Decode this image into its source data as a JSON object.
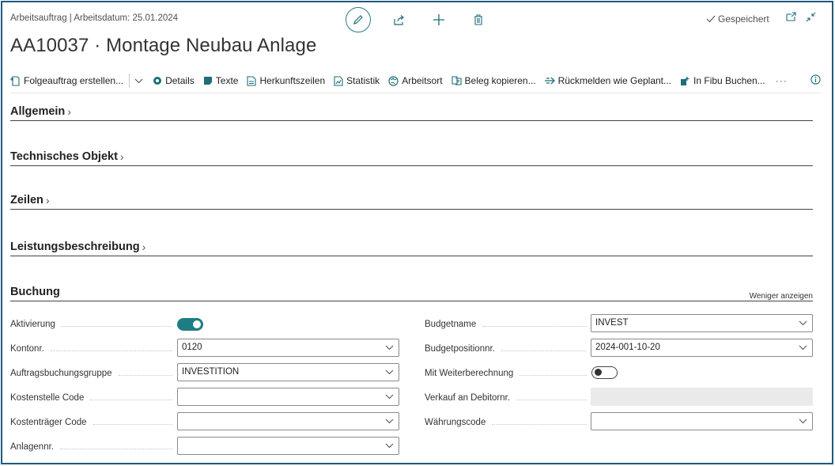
{
  "header": {
    "breadcrumb": "Arbeitsauftrag | Arbeitsdatum: 25.01.2024",
    "title": "AA10037 · Montage Neubau Anlage",
    "saved_label": "Gespeichert"
  },
  "toolbar": {
    "items": [
      {
        "label": "Folgeauftrag erstellen...",
        "icon": "new-document-icon"
      },
      {
        "label": "Details",
        "icon": "details-icon"
      },
      {
        "label": "Texte",
        "icon": "text-icon"
      },
      {
        "label": "Herkunftszeilen",
        "icon": "document-lines-icon"
      },
      {
        "label": "Statistik",
        "icon": "statistics-icon"
      },
      {
        "label": "Arbeitsort",
        "icon": "globe-icon"
      },
      {
        "label": "Beleg kopieren...",
        "icon": "copy-document-icon"
      },
      {
        "label": "Rückmelden wie Geplant...",
        "icon": "report-back-icon"
      },
      {
        "label": "In Fibu Buchen...",
        "icon": "post-icon"
      }
    ],
    "more_label": "···"
  },
  "sections": {
    "allgemein": "Allgemein",
    "technisches_objekt": "Technisches Objekt",
    "zeilen": "Zeilen",
    "leistungsbeschreibung": "Leistungsbeschreibung",
    "buchung": "Buchung",
    "less_label": "Weniger anzeigen"
  },
  "buchung": {
    "aktivierung": {
      "label": "Aktivierung",
      "value": true
    },
    "kontonr": {
      "label": "Kontonr.",
      "value": "0120"
    },
    "auftragsbuchungsgruppe": {
      "label": "Auftragsbuchungsgruppe",
      "value": "INVESTITION"
    },
    "kostenstelle": {
      "label": "Kostenstelle Code",
      "value": ""
    },
    "kostentraeger": {
      "label": "Kostenträger Code",
      "value": ""
    },
    "anlagennr": {
      "label": "Anlagennr.",
      "value": ""
    },
    "budgetname": {
      "label": "Budgetname",
      "value": "INVEST"
    },
    "budgetpositionnr": {
      "label": "Budgetpositionnr.",
      "value": "2024-001-10-20"
    },
    "weiterberechnung": {
      "label": "Mit Weiterberechnung",
      "value": false
    },
    "verkauf_debitor": {
      "label": "Verkauf an Debitornr.",
      "value": ""
    },
    "waehrungscode": {
      "label": "Währungscode",
      "value": ""
    }
  },
  "colors": {
    "accent": "#1e7c84",
    "frame_border": "#1d5a80"
  }
}
